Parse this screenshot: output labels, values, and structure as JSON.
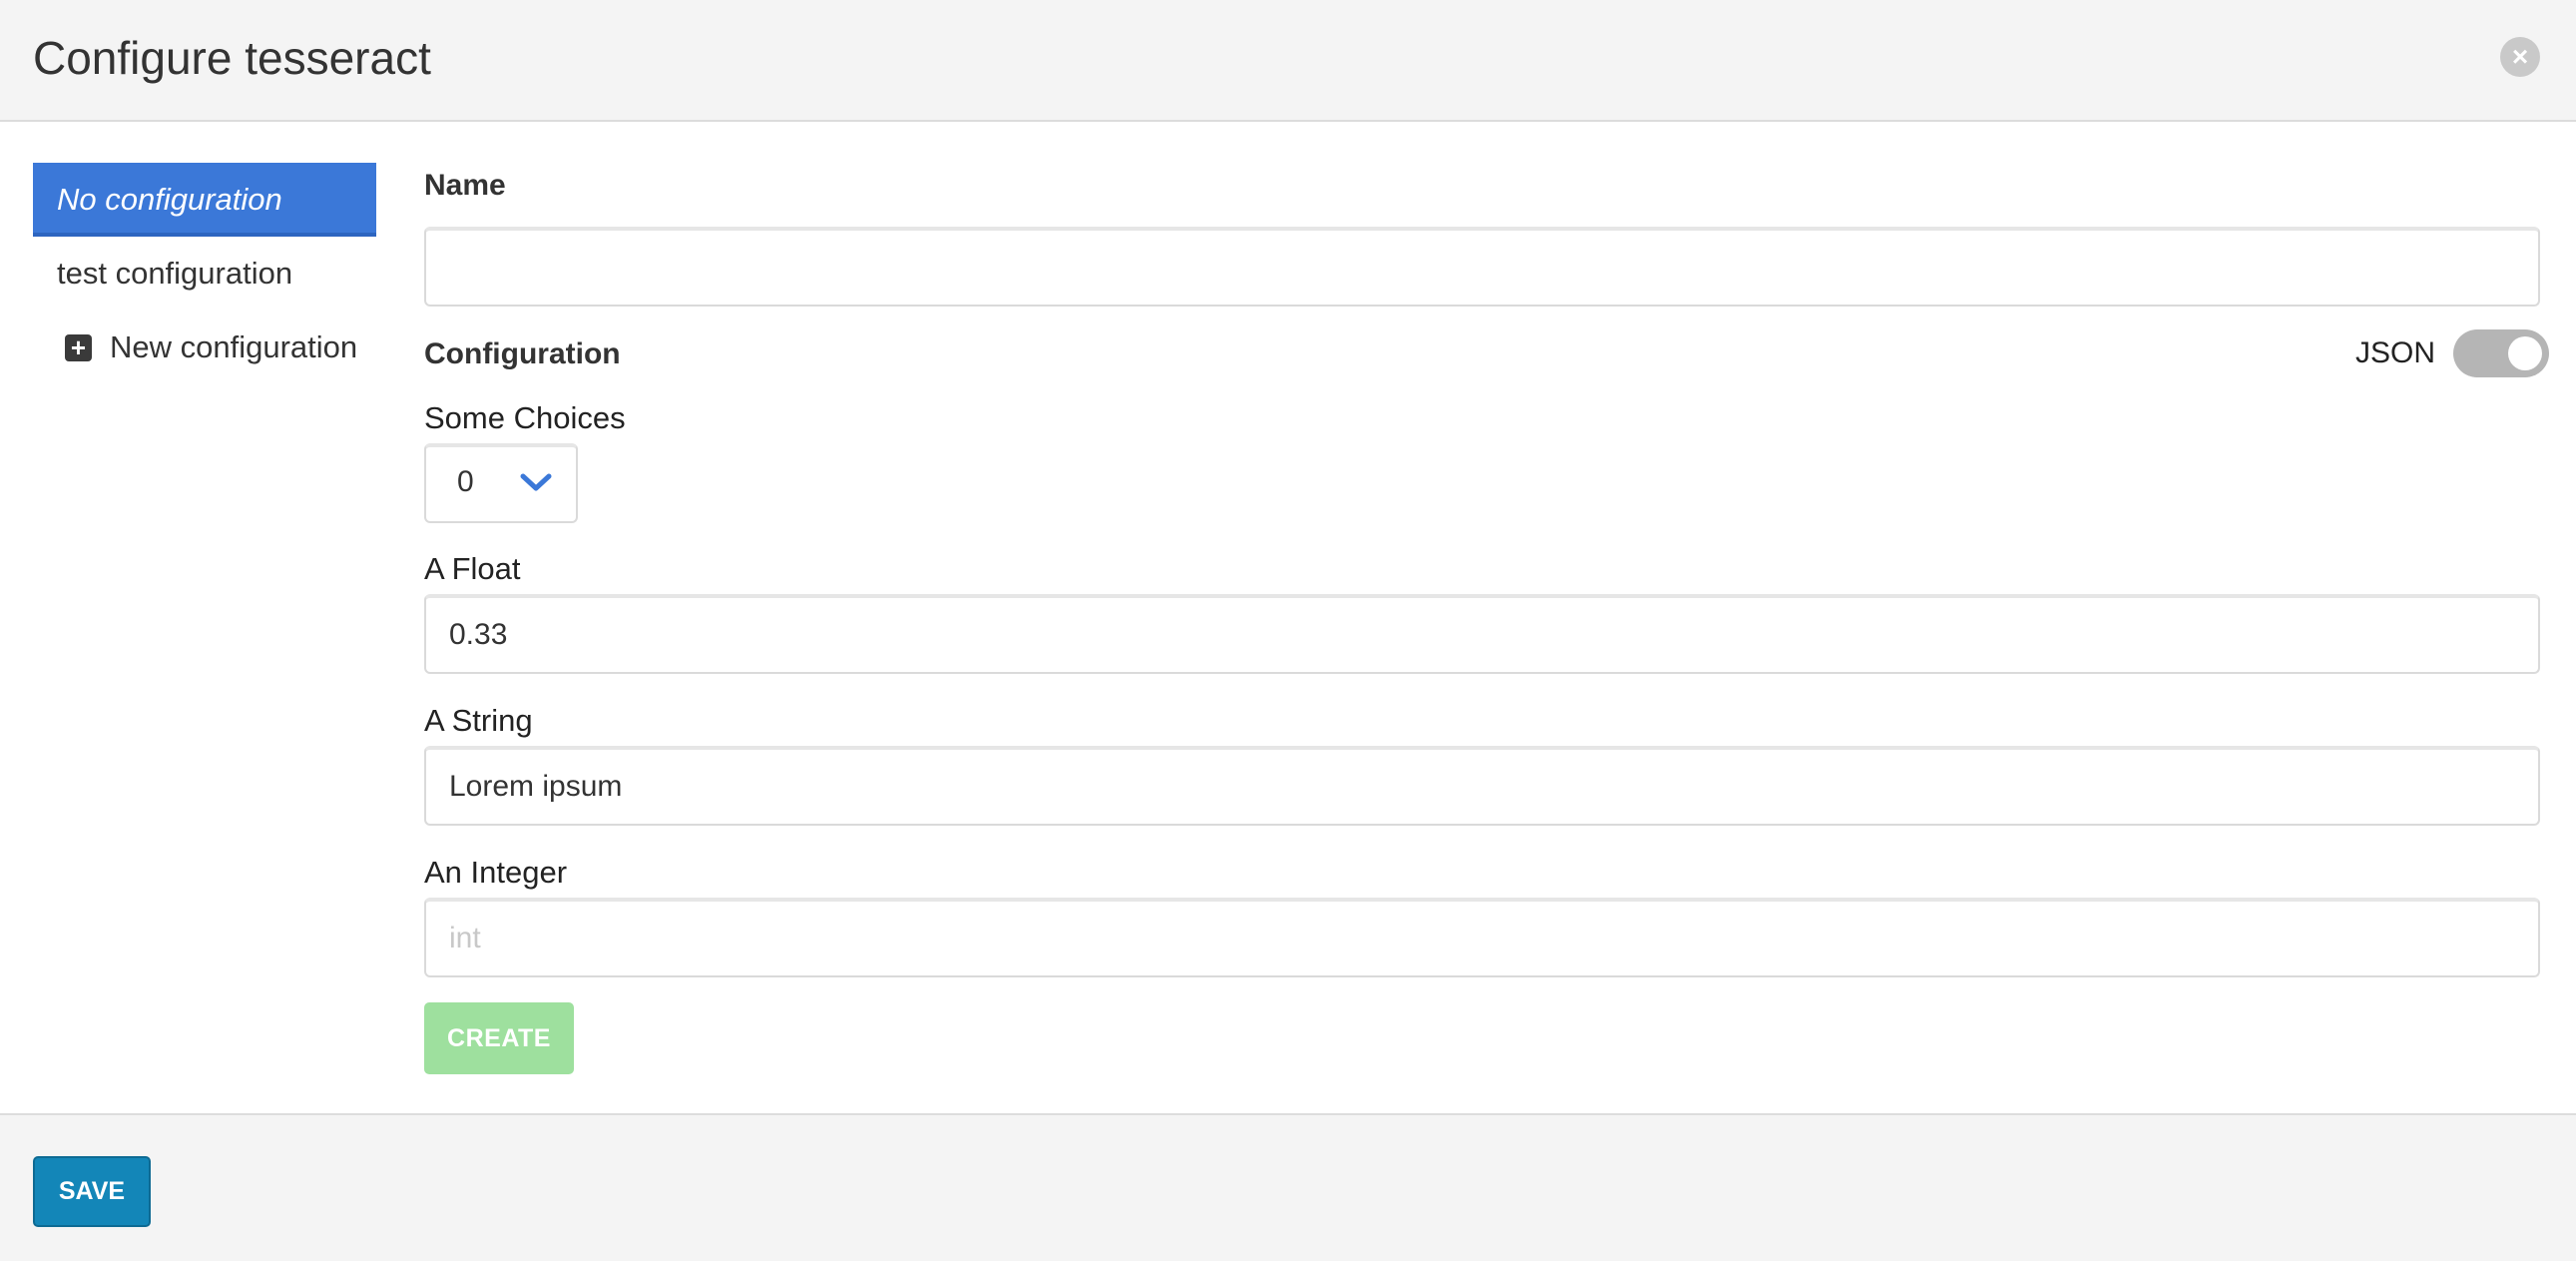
{
  "header": {
    "title": "Configure tesseract",
    "close_symbol": "×"
  },
  "sidebar": {
    "items": [
      {
        "label": "No configuration",
        "active": true
      },
      {
        "label": "test configuration",
        "active": false
      }
    ],
    "new_label": "New configuration",
    "new_icon": "plus-square-icon"
  },
  "form": {
    "name_label": "Name",
    "name_value": "",
    "configuration_label": "Configuration",
    "json_label": "JSON",
    "json_toggle_on": false,
    "some_choices_label": "Some Choices",
    "some_choices_value": "0",
    "float_label": "A Float",
    "float_value": "0.33",
    "string_label": "A String",
    "string_value": "Lorem ipsum",
    "integer_label": "An Integer",
    "integer_value": "",
    "integer_placeholder": "int",
    "create_label": "CREATE"
  },
  "footer": {
    "save_label": "SAVE"
  },
  "colors": {
    "accent": "#3b78d8",
    "save_button": "#1386b8",
    "create_button_disabled": "#9ee09e",
    "toggle_off": "#b5b5b5"
  }
}
